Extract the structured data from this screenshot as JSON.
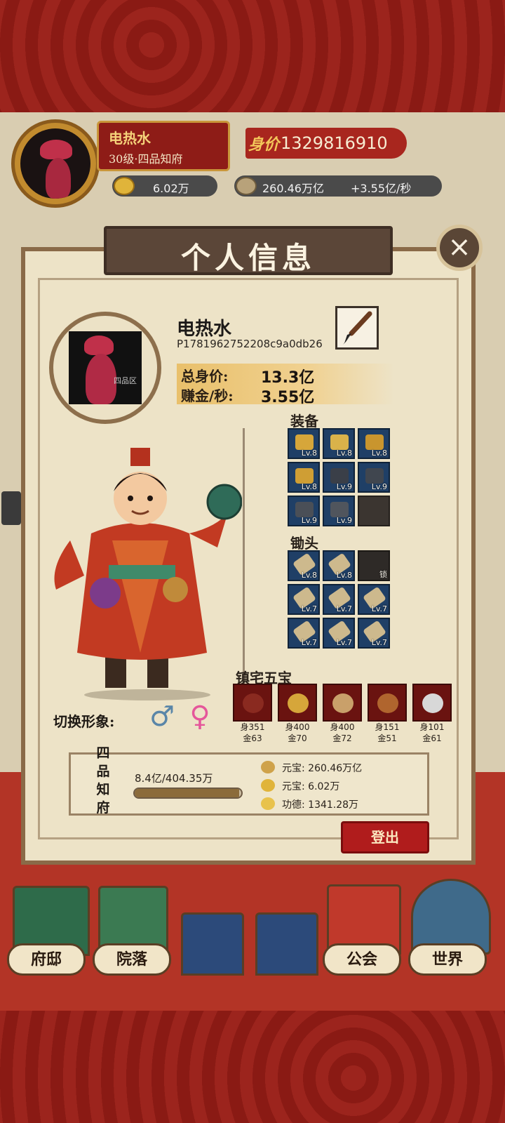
{
  "header": {
    "player_name": "电热水",
    "level_title": "30级·四品知府",
    "worth_label": "身价",
    "worth_value": "1329816910",
    "yuanbao": "6.02万",
    "coins": "260.46万亿",
    "rate": "+3.55亿/秒"
  },
  "panel": {
    "title": "个人信息",
    "close_icon": "×",
    "player_name": "电热水",
    "player_id": "P1781962752208c9a0db26",
    "server_tag": "四品区",
    "total_worth_label": "总身价:",
    "total_worth_value": "13.3亿",
    "earn_label": "赚金/秒:",
    "earn_value": "3.55亿",
    "equipment_title": "装备",
    "equipment": [
      {
        "level": "Lv.8",
        "icon": "helmet-icon",
        "color": "#d6a63a"
      },
      {
        "level": "Lv.8",
        "icon": "armor-icon",
        "color": "#d9b24a"
      },
      {
        "level": "Lv.8",
        "icon": "boots-icon",
        "color": "#c9952e"
      },
      {
        "level": "Lv.8",
        "icon": "amulet-icon",
        "color": "#cf9e34"
      },
      {
        "level": "Lv.9",
        "icon": "bracer-icon",
        "color": "#3a3f48"
      },
      {
        "level": "Lv.9",
        "icon": "gauntlet-icon",
        "color": "#40464f"
      },
      {
        "level": "Lv.9",
        "icon": "ring-icon",
        "color": "#4a4f57"
      },
      {
        "level": "Lv.9",
        "icon": "belt-icon",
        "color": "#50555d"
      },
      {
        "level": "",
        "icon": "",
        "color": ""
      }
    ],
    "hoe_title": "锄头",
    "hoes": [
      {
        "level": "Lv.8",
        "locked": false
      },
      {
        "level": "Lv.8",
        "locked": false
      },
      {
        "level": "",
        "locked": true,
        "lock_text": "锁"
      },
      {
        "level": "Lv.7",
        "locked": false
      },
      {
        "level": "Lv.7",
        "locked": false
      },
      {
        "level": "Lv.7",
        "locked": false
      },
      {
        "level": "Lv.7",
        "locked": false
      },
      {
        "level": "Lv.7",
        "locked": false
      },
      {
        "level": "Lv.7",
        "locked": false
      }
    ],
    "treasures_title": "镇宅五宝",
    "treasures": [
      {
        "shen": "身351",
        "jin": "金63"
      },
      {
        "shen": "身400",
        "jin": "金70"
      },
      {
        "shen": "身400",
        "jin": "金72"
      },
      {
        "shen": "身151",
        "jin": "金51"
      },
      {
        "shen": "身101",
        "jin": "金61"
      }
    ],
    "switch_label": "切换形象:",
    "male_icon": "♂",
    "female_icon": "♀",
    "rank_title": "四品知府",
    "exp_text": "8.4亿/404.35万",
    "exp_progress": 0.98,
    "resources": [
      {
        "label": "元宝: 260.46万亿",
        "color": "#cfa24a"
      },
      {
        "label": "元宝: 6.02万",
        "color": "#e0b43a"
      },
      {
        "label": "功德: 1341.28万",
        "color": "#e8c24c"
      }
    ],
    "logout_label": "登出"
  },
  "nav": {
    "mansion": "府邸",
    "courtyard": "院落",
    "guild": "公会",
    "world": "世界"
  }
}
